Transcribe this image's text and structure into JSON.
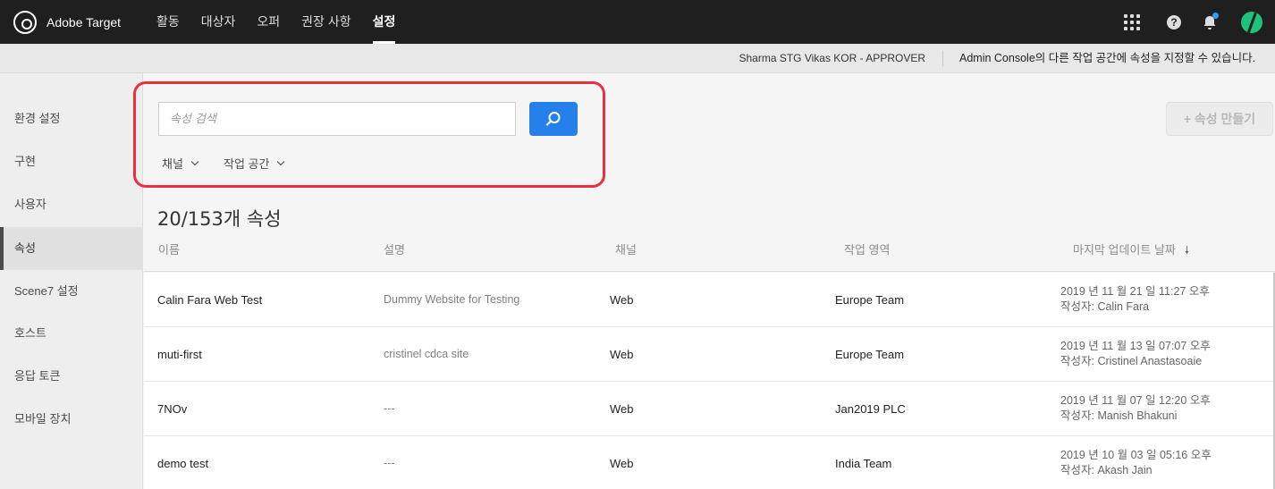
{
  "app": {
    "name": "Adobe Target"
  },
  "nav": [
    "활동",
    "대상자",
    "오퍼",
    "권장 사항",
    "설정"
  ],
  "subbar": {
    "user": "Sharma STG Vikas KOR - APPROVER",
    "message": "Admin Console의 다른 작업 공간에 속성을 지정할 수 있습니다."
  },
  "sidebar": [
    "환경 설정",
    "구현",
    "사용자",
    "속성",
    "Scene7 설정",
    "호스트",
    "응답 토큰",
    "모바일 장치"
  ],
  "search": {
    "placeholder": "속성 검색"
  },
  "filters": {
    "channel": "채널",
    "workspace": "작업 공간"
  },
  "create_button": "+ 속성 만들기",
  "list": {
    "count": "20/153개 속성",
    "columns": [
      "이름",
      "설명",
      "채널",
      "작업 영역",
      "마지막 업데이트 날짜"
    ],
    "rows": [
      {
        "name": "Calin Fara Web Test",
        "description": "Dummy Website for Testing",
        "channel": "Web",
        "workspace": "Europe Team",
        "date": "2019 년 11 월 21 일 11:27 오후",
        "author": "작성자: Calin Fara"
      },
      {
        "name": "muti-first",
        "description": "cristinel cdca site",
        "channel": "Web",
        "workspace": "Europe Team",
        "date": "2019 년 11 월 13 일 07:07 오후",
        "author": "작성자: Cristinel Anastasoaie"
      },
      {
        "name": "7NOv",
        "description": "---",
        "channel": "Web",
        "workspace": "Jan2019 PLC",
        "date": "2019 년 11 월 07 일 12:20 오후",
        "author": "작성자: Manish Bhakuni"
      },
      {
        "name": "demo test",
        "description": "---",
        "channel": "Web",
        "workspace": "India Team",
        "date": "2019 년 10 월 03 일 05:16 오후",
        "author": "작성자: Akash Jain"
      }
    ]
  },
  "colors": {
    "topbar": "#1f1f1f",
    "accent": "#2680eb",
    "highlight": "#e8303f",
    "avatar": "#1fc27a",
    "notification": "#2d9cff"
  },
  "icons": [
    "adobe-target-logo-icon",
    "apps-grid-icon",
    "help-icon",
    "bell-icon",
    "avatar",
    "search-icon",
    "chevron-down-icon",
    "sort-down-icon"
  ]
}
